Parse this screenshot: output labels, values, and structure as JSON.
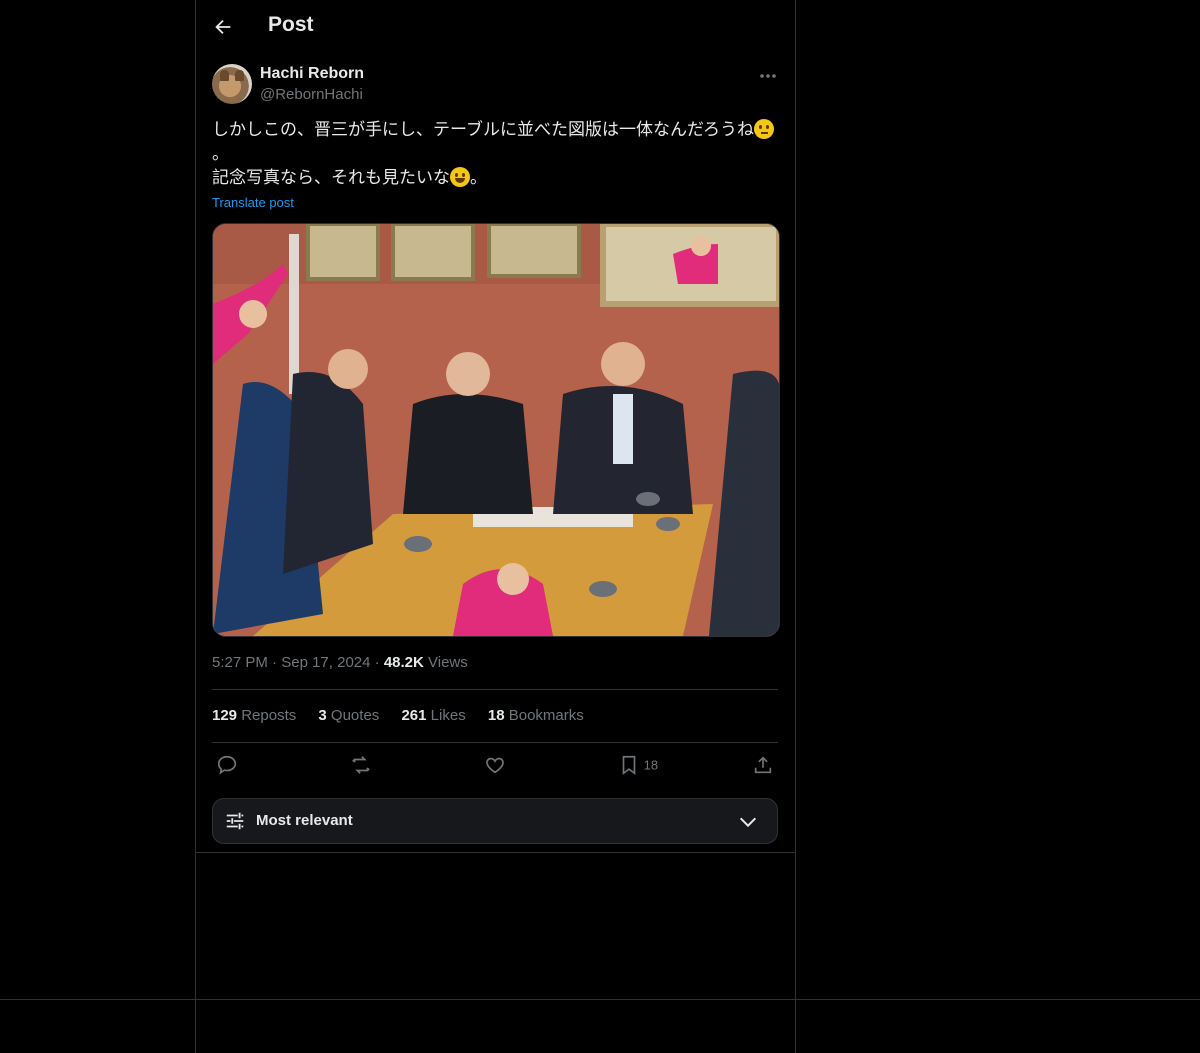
{
  "header": {
    "title": "Post"
  },
  "author": {
    "name": "Hachi Reborn",
    "handle": "@RebornHachi"
  },
  "post": {
    "line1": "しかしこの、晋三が手にし、テーブルに並べた図版は一体なんだろうね",
    "line1_end": "。",
    "line2": "記念写真なら、それも見たいな",
    "line2_end": "。",
    "translate": "Translate post",
    "time": "5:27 PM",
    "date": "Sep 17, 2024",
    "views_count": "48.2K",
    "views_label": "Views"
  },
  "stats": {
    "reposts_count": "129",
    "reposts_label": "Reposts",
    "quotes_count": "3",
    "quotes_label": "Quotes",
    "likes_count": "261",
    "likes_label": "Likes",
    "bookmarks_count": "18",
    "bookmarks_label": "Bookmarks"
  },
  "actions": {
    "bookmark_count": "18"
  },
  "sort": {
    "label": "Most relevant"
  },
  "icons": [
    "back-arrow-icon",
    "more-icon",
    "reply-icon",
    "repost-icon",
    "like-icon",
    "bookmark-icon",
    "share-icon",
    "sliders-icon",
    "chevron-down-icon",
    "thinking-emoji-icon",
    "smiley-emoji-icon"
  ],
  "colors": {
    "background": "#000000",
    "text": "#e7e9ea",
    "muted": "#71767b",
    "link": "#1d9bf0",
    "border": "#2f3336"
  }
}
